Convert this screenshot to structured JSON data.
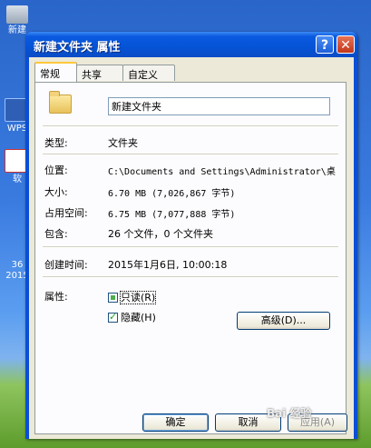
{
  "desktop": {
    "icons": [
      {
        "label": "新建",
        "icon": "folder-icon"
      },
      {
        "label": "WPS",
        "icon": "wps-icon"
      },
      {
        "label": "软",
        "icon": "app-icon"
      },
      {
        "label": "36\n2015",
        "icon": "file-icon"
      }
    ]
  },
  "window": {
    "title": "新建文件夹 属性",
    "help_label": "?",
    "close_label": "✕"
  },
  "tabs": [
    {
      "label": "常规",
      "active": true
    },
    {
      "label": "共享",
      "active": false
    },
    {
      "label": "自定义",
      "active": false
    }
  ],
  "general": {
    "name": "新建文件夹",
    "rows": [
      {
        "label": "类型:",
        "value": "文件夹"
      },
      {
        "label": "位置:",
        "value": "C:\\Documents and Settings\\Administrator\\桌"
      },
      {
        "label": "大小:",
        "value": "6.70 MB (7,026,867 字节)"
      },
      {
        "label": "占用空间:",
        "value": "6.75 MB (7,077,888 字节)"
      },
      {
        "label": "包含:",
        "value": "26 个文件，0 个文件夹"
      },
      {
        "label": "创建时间:",
        "value": "2015年1月6日, 10:00:18"
      }
    ],
    "attributes_label": "属性:",
    "readonly_label": "只读(R)",
    "readonly_state": "partial",
    "hidden_label": "隐藏(H)",
    "hidden_state": "checked",
    "advanced_label": "高级(D)..."
  },
  "buttons": {
    "ok": "确定",
    "cancel": "取消",
    "apply": "应用(A)"
  },
  "watermark": "Bai 经验"
}
